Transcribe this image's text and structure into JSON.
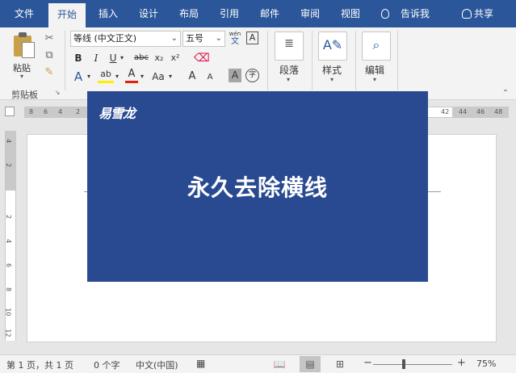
{
  "tabs": [
    "文件",
    "开始",
    "插入",
    "设计",
    "布局",
    "引用",
    "邮件",
    "审阅",
    "视图"
  ],
  "tell_me": "告诉我",
  "share": "共享",
  "clipboard": {
    "paste_label": "粘贴",
    "group_label": "剪贴板"
  },
  "font": {
    "name_value": "等线 (中文正文)",
    "size_value": "五号",
    "pinyin_top": "wén",
    "pinyin_bottom": "文",
    "border_char": "A",
    "bold": "B",
    "italic": "I",
    "underline": "U",
    "strike": "abc",
    "subscript": "x₂",
    "superscript": "x²",
    "effects": "A",
    "highlight": "ab",
    "font_color": "A",
    "change_case": "Aa",
    "grow": "A",
    "shrink": "A",
    "shading": "A",
    "enclose": "字"
  },
  "paragraph": {
    "label": "段落"
  },
  "styles": {
    "label": "样式"
  },
  "editing": {
    "label": "编辑"
  },
  "ruler": {
    "left_numbers": [
      "8",
      "6",
      "4",
      "2"
    ],
    "right_numbers": [
      "42",
      "44",
      "46",
      "48"
    ],
    "vertical_numbers": [
      "4",
      "2",
      "2",
      "4",
      "6",
      "8",
      "10",
      "12"
    ]
  },
  "banner": {
    "brand": "易雪龙",
    "headline": "永久去除横线"
  },
  "status": {
    "page": "第 1 页，共 1 页",
    "words": "0 个字",
    "language": "中文(中国)",
    "zoom_minus": "−",
    "zoom_plus": "+",
    "zoom": "75%"
  },
  "colors": {
    "ribbon_blue": "#2b579a",
    "banner_blue": "#294a91"
  }
}
